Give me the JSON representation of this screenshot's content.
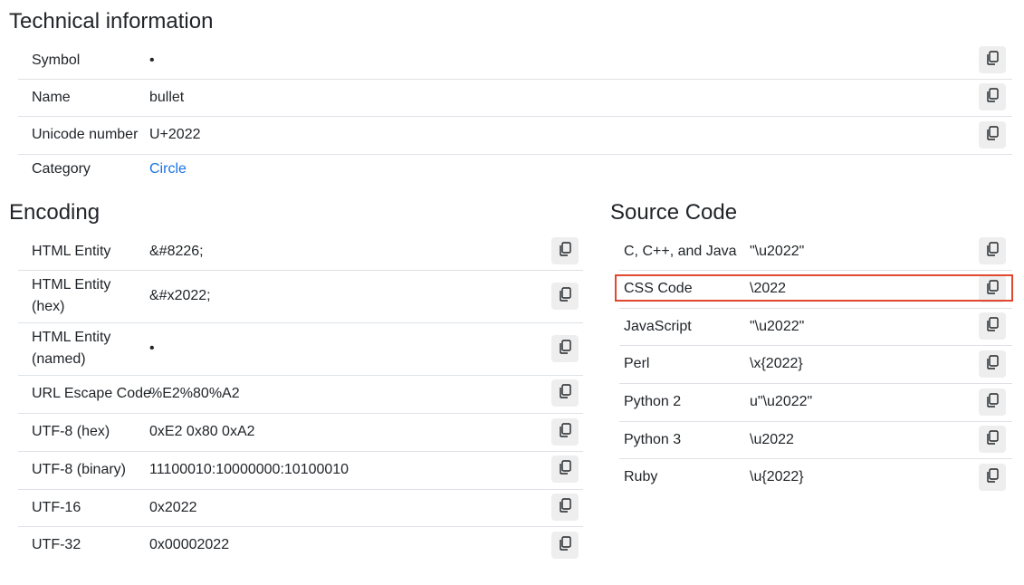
{
  "technical": {
    "title": "Technical information",
    "rows": [
      {
        "label": "Symbol",
        "value": "•"
      },
      {
        "label": "Name",
        "value": "bullet"
      },
      {
        "label": "Unicode number",
        "value": "U+2022"
      },
      {
        "label": "Category",
        "value": "Circle"
      }
    ]
  },
  "encoding": {
    "title": "Encoding",
    "rows": [
      {
        "label": "HTML Entity",
        "value": "&#8226;"
      },
      {
        "label": "HTML Entity (hex)",
        "value": "&#x2022;"
      },
      {
        "label": "HTML Entity (named)",
        "value": "•"
      },
      {
        "label": "URL Escape Code",
        "value": "%E2%80%A2"
      },
      {
        "label": "UTF-8 (hex)",
        "value": "0xE2 0x80 0xA2"
      },
      {
        "label": "UTF-8 (binary)",
        "value": "11100010:10000000:10100010"
      },
      {
        "label": "UTF-16",
        "value": "0x2022"
      },
      {
        "label": "UTF-32",
        "value": "0x00002022"
      }
    ]
  },
  "source": {
    "title": "Source Code",
    "rows": [
      {
        "label": "C, C++, and Java",
        "value": "\"\\u2022\""
      },
      {
        "label": "CSS Code",
        "value": "\\2022"
      },
      {
        "label": "JavaScript",
        "value": "\"\\u2022\""
      },
      {
        "label": "Perl",
        "value": "\\x{2022}"
      },
      {
        "label": "Python 2",
        "value": "u\"\\u2022\""
      },
      {
        "label": "Python 3",
        "value": "\\u2022"
      },
      {
        "label": "Ruby",
        "value": "\\u{2022}"
      }
    ]
  },
  "icons": {
    "copy": "copy-icon"
  },
  "colors": {
    "link": "#1a73e8",
    "highlight": "#e2472f"
  }
}
